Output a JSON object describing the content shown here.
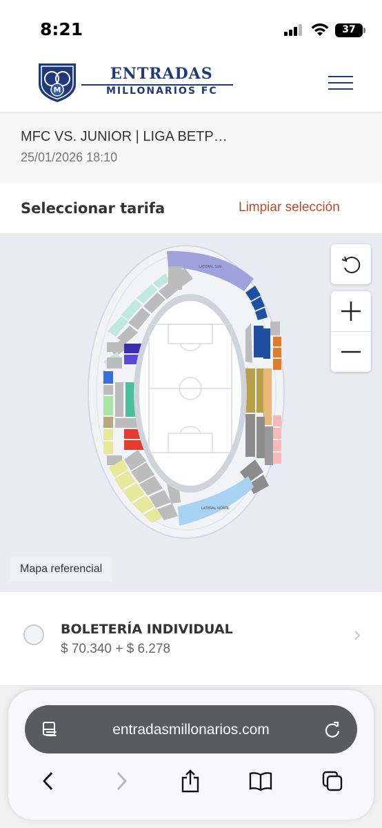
{
  "status_bar": {
    "time": "8:21",
    "battery": "37"
  },
  "header": {
    "logo_title": "ENTRADAS",
    "logo_subtitle": "MILLONARIOS FC",
    "brand_color": "#1f3a7a"
  },
  "event": {
    "title": "MFC VS. JUNIOR | LIGA BETP…",
    "date": "25/01/2026 18:10"
  },
  "rate": {
    "title": "Seleccionar tarifa",
    "clear_label": "Limpiar selección",
    "clear_color": "#b84a2a"
  },
  "map": {
    "label": "Mapa referencial",
    "stand_south": "LATERAL SUR",
    "stand_north": "LATERAL NORTE",
    "controls": [
      "rotate-icon",
      "zoom-in-icon",
      "zoom-out-icon"
    ]
  },
  "ticket": {
    "title": "BOLETERÍA INDIVIDUAL",
    "price": "$ 70.340 + $ 6.278"
  },
  "browser": {
    "url": "entradasmillonarios.com",
    "nav": [
      "back-icon",
      "forward-icon",
      "share-icon",
      "bookmarks-icon",
      "tabs-icon"
    ]
  }
}
